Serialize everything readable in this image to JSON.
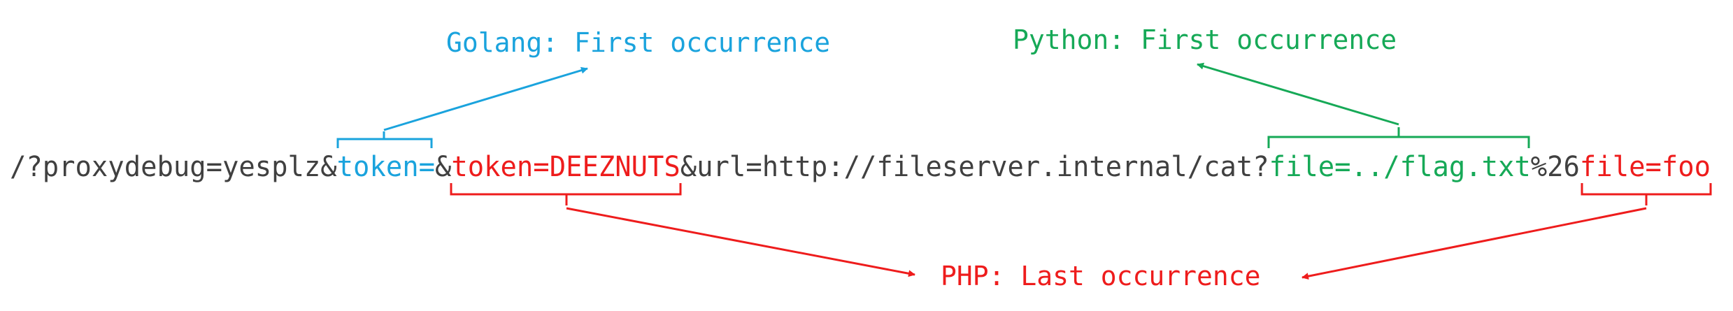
{
  "url": {
    "prefix": "/?proxydebug=yesplz&",
    "token_empty": "token=",
    "amp": "&",
    "token_full": "token=DEEZNUTS",
    "middle": "&url=http://fileserver.internal/cat?",
    "file_first": "file=../flag.txt",
    "encoded_amp": "%26",
    "file_last": "file=foo"
  },
  "labels": {
    "golang": "Golang: First occurrence",
    "python": "Python: First occurrence",
    "php": "PHP: Last occurrence"
  },
  "colors": {
    "text": "#404040",
    "golang": "#1aa3dd",
    "python": "#16a957",
    "php": "#ee1c1c"
  }
}
